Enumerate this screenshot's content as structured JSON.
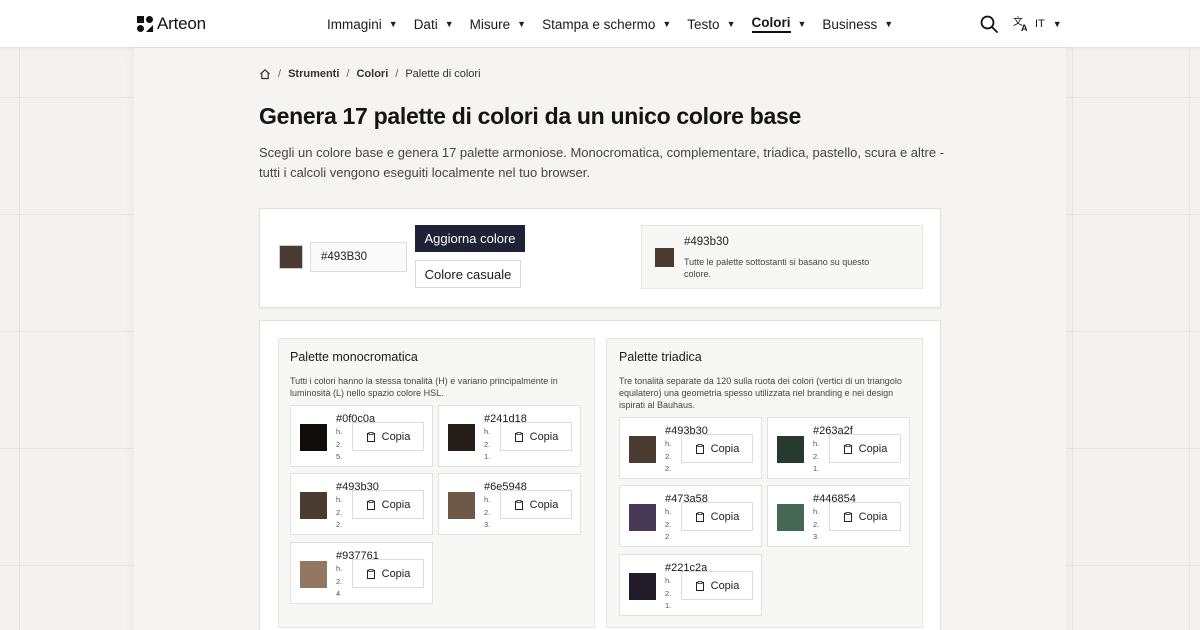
{
  "header": {
    "logo": "Arteon",
    "nav": [
      {
        "label": "Immagini",
        "active": false
      },
      {
        "label": "Dati",
        "active": false
      },
      {
        "label": "Misure",
        "active": false
      },
      {
        "label": "Stampa e schermo",
        "active": false
      },
      {
        "label": "Testo",
        "active": false
      },
      {
        "label": "Colori",
        "active": true
      },
      {
        "label": "Business",
        "active": false
      }
    ],
    "lang": "IT",
    "icons": {
      "search": "search-icon",
      "translate": "translate-icon",
      "home": "home-icon"
    }
  },
  "breadcrumb": [
    "Strumenti",
    "Colori",
    "Palette di colori"
  ],
  "page": {
    "title": "Genera 17 palette di colori da un unico colore base",
    "description": "Scegli un colore base e genera 17 palette armoniose. Monocromatica, complementare, triadica, pastello, scura e altre - tutti i calcoli vengono eseguiti localmente nel tuo browser."
  },
  "controls": {
    "base_color": "#493b30",
    "hex_value": "#493B30",
    "update_label": "Aggiorna colore",
    "random_label": "Colore casuale",
    "info_hex": "#493b30",
    "info_note": "Tutte le palette sottostanti si basano su questo colore."
  },
  "palettes": {
    "copy_label": "Copia",
    "mono": {
      "title": "Palette monocromatica",
      "desc": "Tutti i colori hanno la stessa tonalità (H) e variano principalmente in luminosità (L) nello spazio colore HSL.",
      "colors": [
        {
          "hex": "#0f0c0a",
          "meta": [
            "h.",
            "2.",
            "5."
          ]
        },
        {
          "hex": "#241d18",
          "meta": [
            "h.",
            "2.",
            "1."
          ]
        },
        {
          "hex": "#493b30",
          "meta": [
            "h.",
            "2.",
            "2."
          ]
        },
        {
          "hex": "#6e5948",
          "meta": [
            "h.",
            "2.",
            "3."
          ]
        },
        {
          "hex": "#937761",
          "meta": [
            "h.",
            "2.",
            "4"
          ]
        }
      ]
    },
    "triad": {
      "title": "Palette triadica",
      "desc": "Tre tonalità separate da 120 sulla ruota dei colori (vertici di un triangolo equilatero) una geometria spesso utilizzata nel branding e nei design ispirati al Bauhaus.",
      "colors": [
        {
          "hex": "#493b30",
          "meta": [
            "h.",
            "2.",
            "2."
          ]
        },
        {
          "hex": "#263a2f",
          "meta": [
            "h.",
            "2.",
            "1."
          ]
        },
        {
          "hex": "#473a58",
          "meta": [
            "h.",
            "2.",
            "2"
          ]
        },
        {
          "hex": "#446854",
          "meta": [
            "h.",
            "2.",
            "3."
          ]
        },
        {
          "hex": "#221c2a",
          "meta": [
            "h.",
            "2.",
            "1."
          ]
        }
      ]
    }
  }
}
